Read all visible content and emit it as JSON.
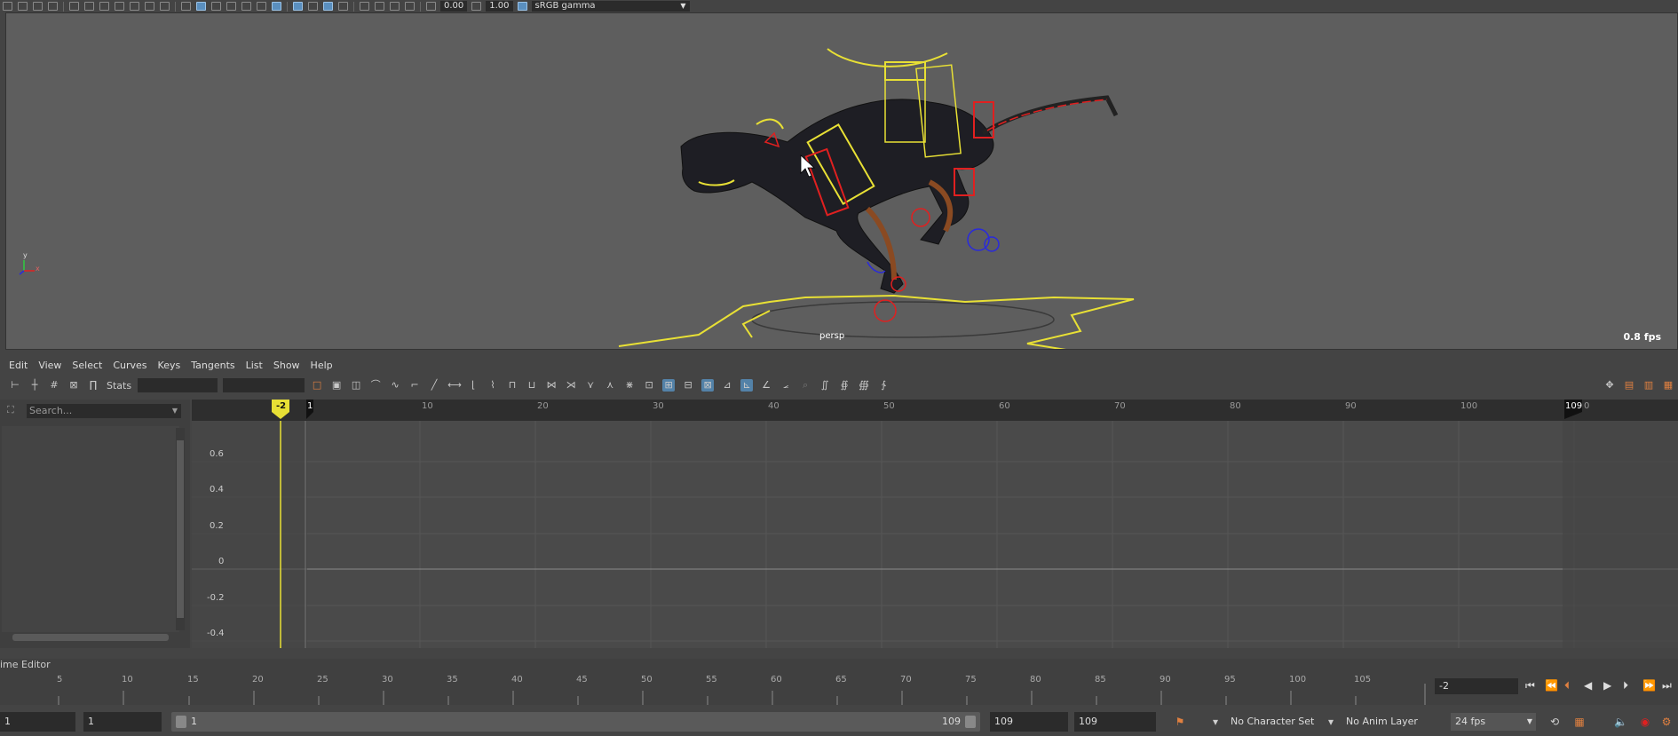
{
  "toolbar": {
    "field_a": "0.00",
    "field_b": "1.00",
    "color_space": "sRGB gamma"
  },
  "viewport": {
    "camera_label": "persp",
    "fps": "0.8 fps",
    "axis_y": "y",
    "axis_x": "x"
  },
  "graph_editor": {
    "menus": [
      "Edit",
      "View",
      "Select",
      "Curves",
      "Keys",
      "Tangents",
      "List",
      "Show",
      "Help"
    ],
    "stats_label": "Stats",
    "search_placeholder": "Search...",
    "current_frame_marker": "-2",
    "start_marker": "1",
    "end_marker": "109",
    "ruler_ticks": [
      "10",
      "20",
      "30",
      "40",
      "50",
      "60",
      "70",
      "80",
      "90",
      "100"
    ],
    "ruler_tail": "0",
    "value_labels": [
      "0.6",
      "0.4",
      "0.2",
      "0",
      "-0.2",
      "-0.4"
    ]
  },
  "time_editor_label": "ime Editor",
  "time_slider": {
    "ticks": [
      "5",
      "10",
      "15",
      "20",
      "25",
      "30",
      "35",
      "40",
      "45",
      "50",
      "55",
      "60",
      "65",
      "70",
      "75",
      "80",
      "85",
      "90",
      "95",
      "100",
      "105"
    ],
    "current_frame": "-2"
  },
  "range": {
    "start_time": "1",
    "playback_start": "1",
    "range_start": "1",
    "range_end": "109",
    "playback_end": "109",
    "end_time": "109",
    "character_set": "No Character Set",
    "anim_layer": "No Anim Layer",
    "fps": "24 fps"
  },
  "colors": {
    "curve_yellow": "#e8e035",
    "key_red": "#e02020",
    "viewport_bg": "#5e5e5e"
  }
}
